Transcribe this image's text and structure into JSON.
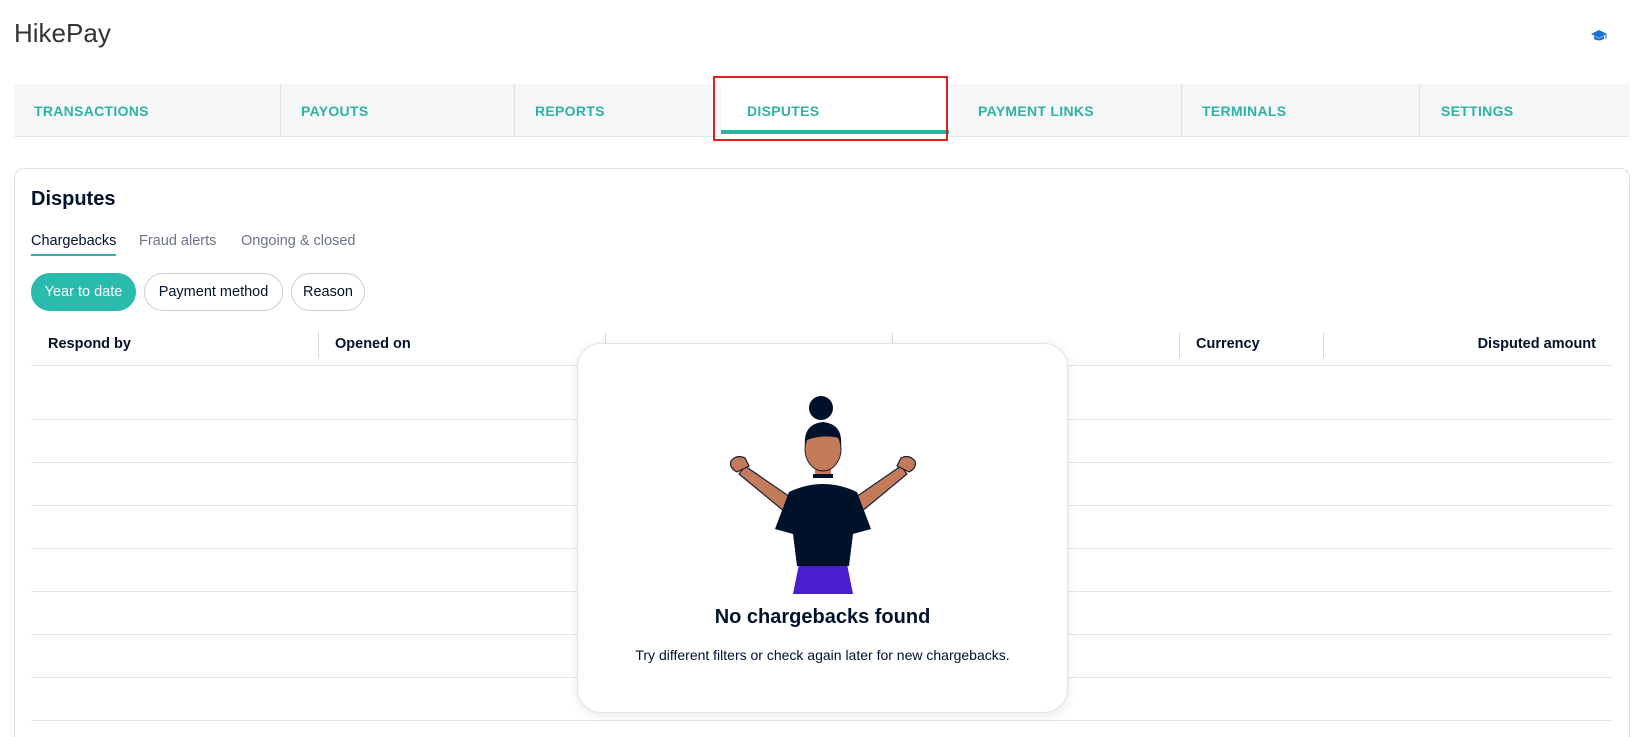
{
  "app": {
    "title": "HikePay"
  },
  "nav": {
    "tabs": [
      {
        "label": "TRANSACTIONS"
      },
      {
        "label": "PAYOUTS"
      },
      {
        "label": "REPORTS"
      },
      {
        "label": "DISPUTES",
        "active": true
      },
      {
        "label": "PAYMENT LINKS"
      },
      {
        "label": "TERMINALS"
      },
      {
        "label": "SETTINGS"
      }
    ]
  },
  "disputes": {
    "title": "Disputes",
    "subtabs": [
      {
        "label": "Chargebacks",
        "active": true
      },
      {
        "label": "Fraud alerts"
      },
      {
        "label": "Ongoing & closed"
      }
    ],
    "filters": [
      {
        "label": "Year to date",
        "active": true
      },
      {
        "label": "Payment method"
      },
      {
        "label": "Reason"
      }
    ],
    "columns": [
      "Respond by",
      "Opened on",
      "",
      "",
      "Currency",
      "Disputed amount"
    ],
    "empty_state": {
      "title": "No chargebacks found",
      "text": "Try different filters or check again later for new chargebacks."
    }
  },
  "colors": {
    "accent": "#2bb3a6",
    "highlight": "#e41e1e",
    "text": "#00112c"
  },
  "icons": {
    "help": "graduation-cap-icon"
  }
}
